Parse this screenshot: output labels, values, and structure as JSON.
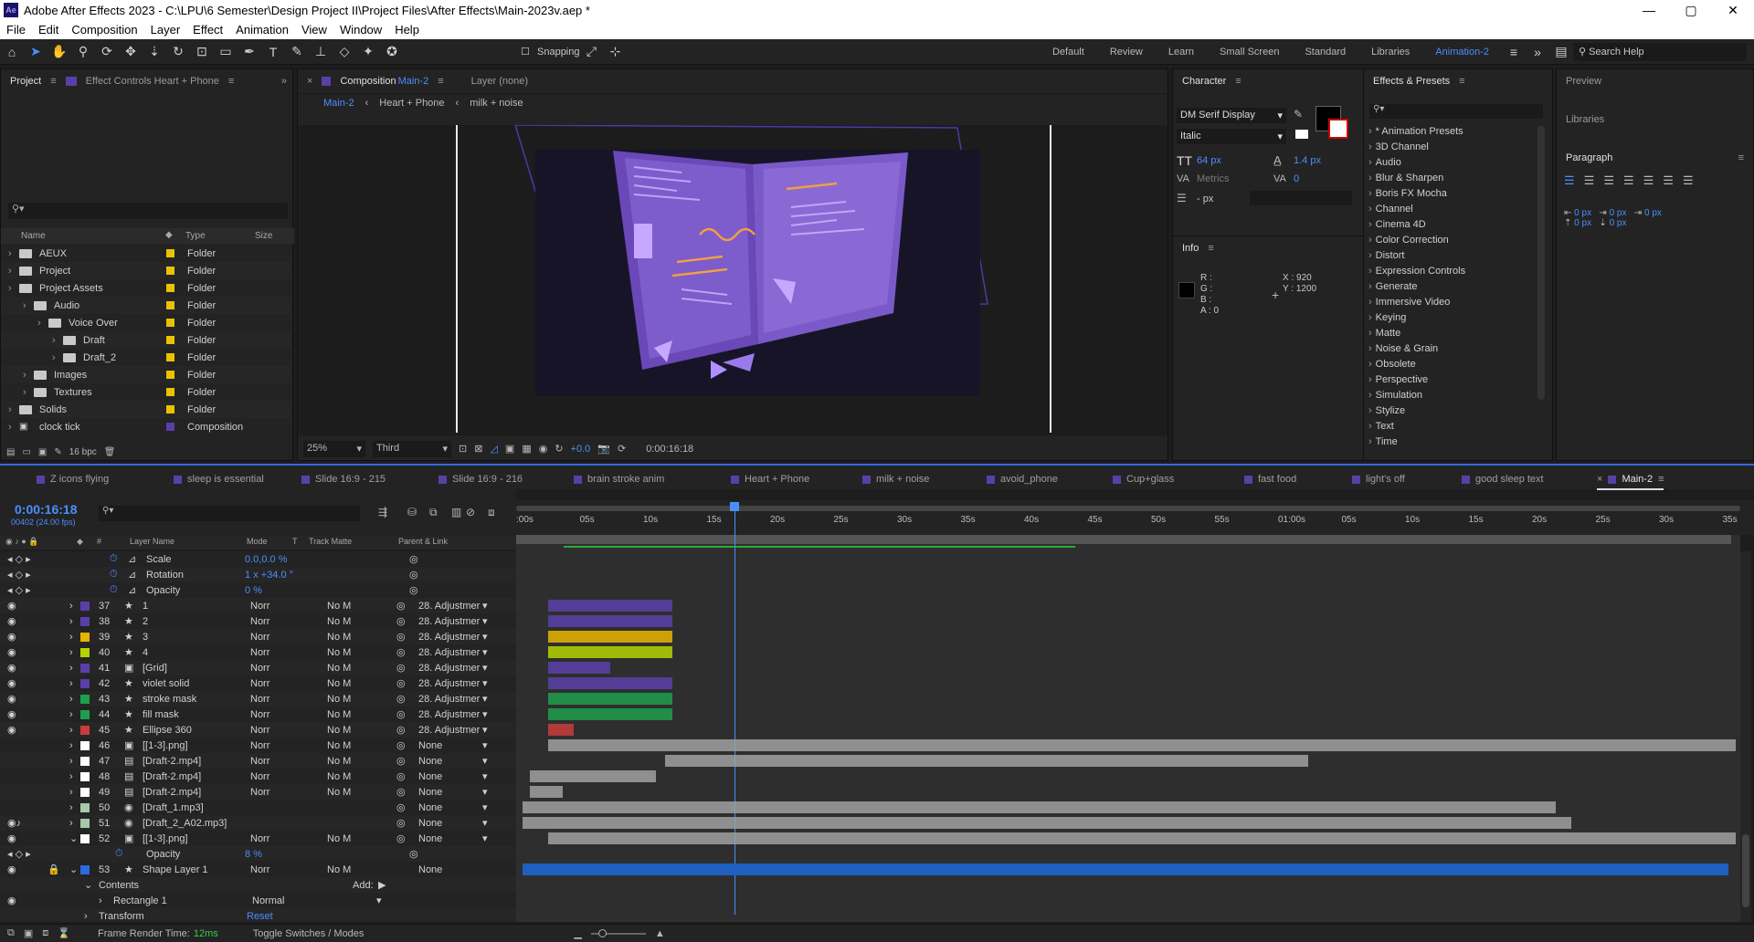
{
  "window": {
    "title": "Adobe After Effects 2023 - C:\\LPU\\6 Semester\\Design Project II\\Project Files\\After Effects\\Main-2023v.aep *",
    "logo": "Ae"
  },
  "menu": [
    "File",
    "Edit",
    "Composition",
    "Layer",
    "Effect",
    "Animation",
    "View",
    "Window",
    "Help"
  ],
  "toolbar": {
    "snapping": "Snapping",
    "workspaces": [
      "Default",
      "Review",
      "Learn",
      "Small Screen",
      "Standard",
      "Libraries",
      "Animation-2"
    ],
    "active_workspace": "Animation-2",
    "search_help": "Search Help"
  },
  "project_panel": {
    "tab_project": "Project",
    "tab_effect_controls": "Effect Controls Heart + Phone",
    "columns": [
      "Name",
      "Type",
      "Size"
    ],
    "items": [
      {
        "name": "AEUX",
        "type": "Folder",
        "indent": 0,
        "kind": "folder"
      },
      {
        "name": "Project",
        "type": "Folder",
        "indent": 0,
        "kind": "folder"
      },
      {
        "name": "Project Assets",
        "type": "Folder",
        "indent": 0,
        "kind": "folder"
      },
      {
        "name": "Audio",
        "type": "Folder",
        "indent": 1,
        "kind": "folder"
      },
      {
        "name": "Voice Over",
        "type": "Folder",
        "indent": 2,
        "kind": "folder"
      },
      {
        "name": "Draft",
        "type": "Folder",
        "indent": 3,
        "kind": "folder"
      },
      {
        "name": "Draft_2",
        "type": "Folder",
        "indent": 3,
        "kind": "folder"
      },
      {
        "name": "Images",
        "type": "Folder",
        "indent": 1,
        "kind": "folder"
      },
      {
        "name": "Textures",
        "type": "Folder",
        "indent": 1,
        "kind": "folder"
      },
      {
        "name": "Solids",
        "type": "Folder",
        "indent": 0,
        "kind": "folder"
      },
      {
        "name": "clock tick",
        "type": "Composition",
        "indent": 0,
        "kind": "comp"
      }
    ],
    "bpc": "16 bpc"
  },
  "composition_panel": {
    "tab_label": "Composition",
    "comp_name": "Main-2",
    "layer_tab": "Layer (none)",
    "breadcrumbs": [
      "Main-2",
      "Heart + Phone",
      "milk + noise"
    ],
    "zoom": "25%",
    "resolution": "Third",
    "exposure": "+0.0",
    "timecode": "0:00:16:18"
  },
  "character_panel": {
    "title": "Character",
    "font": "DM Serif Display",
    "style": "Italic",
    "size": "64 px",
    "leading": "1.4 px",
    "kerning": "Metrics",
    "tracking": "0",
    "stroke": "- px"
  },
  "info_panel": {
    "title": "Info",
    "r": "R :",
    "g": "G :",
    "b": "B :",
    "a": "A : 0",
    "x": "X : 920",
    "y": "Y : 1200"
  },
  "effects_panel": {
    "title": "Effects & Presets",
    "items": [
      "* Animation Presets",
      "3D Channel",
      "Audio",
      "Blur & Sharpen",
      "Boris FX Mocha",
      "Channel",
      "Cinema 4D",
      "Color Correction",
      "Distort",
      "Expression Controls",
      "Generate",
      "Immersive Video",
      "Keying",
      "Matte",
      "Noise & Grain",
      "Obsolete",
      "Perspective",
      "Simulation",
      "Stylize",
      "Text",
      "Time"
    ]
  },
  "right_panels": {
    "preview": "Preview",
    "libraries": "Libraries",
    "paragraph": "Paragraph",
    "indent_values": [
      "0 px",
      "0 px",
      "0 px",
      "0 px",
      "0 px"
    ]
  },
  "timeline": {
    "tabs": [
      "Z icons flying",
      "sleep is essential",
      "Slide 16:9 - 215",
      "Slide 16:9 - 216",
      "brain stroke anim",
      "Heart + Phone",
      "milk + noise",
      "avoid_phone",
      "Cup+glass",
      "fast food",
      "light's off",
      "good sleep text",
      "Main-2"
    ],
    "tab_colors": [
      "#5a3fa8",
      "#5a3fa8",
      "#5a3fa8",
      "#5a3fa8",
      "#5a3fa8",
      "#5a3fa8",
      "#5a3fa8",
      "#5a3fa8",
      "#5a3fa8",
      "#5a3fa8",
      "#5a3fa8",
      "#5a3fa8",
      "#5a3fa8"
    ],
    "active_tab": "Main-2",
    "timecode": "0:00:16:18",
    "frames": "00402 (24.00 fps)",
    "col_headers": {
      "layer_name": "Layer Name",
      "mode": "Mode",
      "t": "T",
      "track_matte": "Track Matte",
      "parent": "Parent & Link"
    },
    "ruler": [
      ":00s",
      "05s",
      "10s",
      "15s",
      "20s",
      "25s",
      "30s",
      "35s",
      "40s",
      "45s",
      "50s",
      "55s",
      "01:00s",
      "05s",
      "10s",
      "15s",
      "20s",
      "25s",
      "30s",
      "35s"
    ],
    "props_top": [
      {
        "name": "Scale",
        "value": "0.0,0.0 %"
      },
      {
        "name": "Rotation",
        "value": "1 x +34.0 °"
      },
      {
        "name": "Opacity",
        "value": "0 %"
      }
    ],
    "layers": [
      {
        "num": "37",
        "name": "1",
        "color": "#5a3fa8",
        "mode": "Norr",
        "matte": "No M",
        "parent": "28. Adjustmer",
        "kind": "star"
      },
      {
        "num": "38",
        "name": "2",
        "color": "#5a3fa8",
        "mode": "Norr",
        "matte": "No M",
        "parent": "28. Adjustmer",
        "kind": "star"
      },
      {
        "num": "39",
        "name": "3",
        "color": "#e8b400",
        "mode": "Norr",
        "matte": "No M",
        "parent": "28. Adjustmer",
        "kind": "star"
      },
      {
        "num": "40",
        "name": "4",
        "color": "#b4d400",
        "mode": "Norr",
        "matte": "No M",
        "parent": "28. Adjustmer",
        "kind": "star"
      },
      {
        "num": "41",
        "name": "[Grid]",
        "color": "#5a3fa8",
        "mode": "Norr",
        "matte": "No M",
        "parent": "28. Adjustmer",
        "kind": "comp"
      },
      {
        "num": "42",
        "name": "violet solid",
        "color": "#5a3fa8",
        "mode": "Norr",
        "matte": "No M",
        "parent": "28. Adjustmer",
        "kind": "star"
      },
      {
        "num": "43",
        "name": "stroke mask",
        "color": "#1e9e4e",
        "mode": "Norr",
        "matte": "No M",
        "parent": "28. Adjustmer",
        "kind": "star"
      },
      {
        "num": "44",
        "name": "fill mask",
        "color": "#1e9e4e",
        "mode": "Norr",
        "matte": "No M",
        "parent": "28. Adjustmer",
        "kind": "star"
      },
      {
        "num": "45",
        "name": "Ellipse 360",
        "color": "#c83c3c",
        "mode": "Norr",
        "matte": "No M",
        "parent": "28. Adjustmer",
        "kind": "star"
      },
      {
        "num": "46",
        "name": "[[1-3].png]",
        "color": "#ffffff",
        "mode": "Norr",
        "matte": "No M",
        "parent": "None",
        "kind": "comp"
      },
      {
        "num": "47",
        "name": "[Draft-2.mp4]",
        "color": "#ffffff",
        "mode": "Norr",
        "matte": "No M",
        "parent": "None",
        "kind": "file"
      },
      {
        "num": "48",
        "name": "[Draft-2.mp4]",
        "color": "#ffffff",
        "mode": "Norr",
        "matte": "No M",
        "parent": "None",
        "kind": "file"
      },
      {
        "num": "49",
        "name": "[Draft-2.mp4]",
        "color": "#ffffff",
        "mode": "Norr",
        "matte": "No M",
        "parent": "None",
        "kind": "file"
      },
      {
        "num": "50",
        "name": "[Draft_1.mp3]",
        "color": "#a8c8a8",
        "mode": "",
        "matte": "",
        "parent": "None",
        "kind": "audio"
      },
      {
        "num": "51",
        "name": "[Draft_2_A02.mp3]",
        "color": "#a8c8a8",
        "mode": "",
        "matte": "",
        "parent": "None",
        "kind": "audio"
      },
      {
        "num": "52",
        "name": "[[1-3].png]",
        "color": "#ffffff",
        "mode": "Norr",
        "matte": "No M",
        "parent": "None",
        "kind": "comp"
      }
    ],
    "opacity_prop": {
      "name": "Opacity",
      "value": "8 %"
    },
    "shape_layer": {
      "num": "53",
      "name": "Shape Layer 1",
      "mode": "Norr",
      "matte": "No M",
      "parent": "None"
    },
    "contents": "Contents",
    "add": "Add:",
    "rectangle": "Rectangle 1",
    "rect_mode": "Normal",
    "transform": "Transform",
    "reset": "Reset",
    "frame_render_label": "Frame Render Time:",
    "frame_render_value": "12ms",
    "toggle": "Toggle Switches / Modes"
  }
}
